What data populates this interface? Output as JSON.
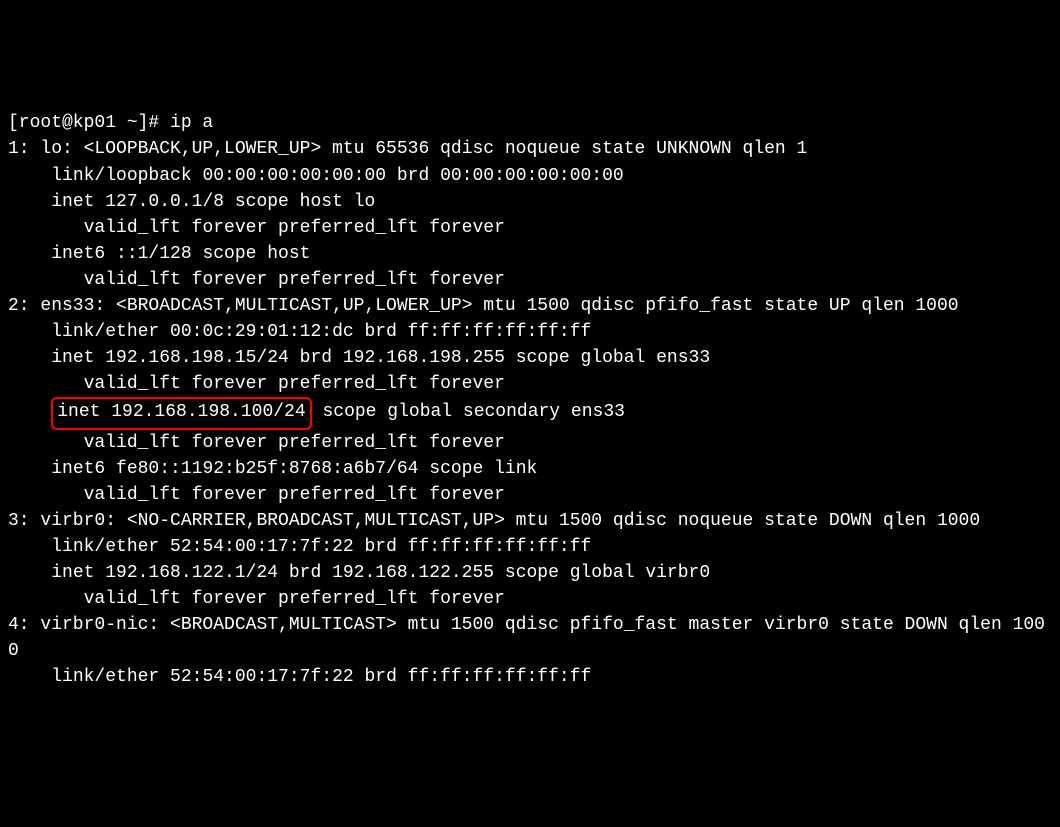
{
  "terminal": {
    "prompt": "[root@kp01 ~]# ",
    "command": "ip a",
    "output": {
      "l00": "1: lo: <LOOPBACK,UP,LOWER_UP> mtu 65536 qdisc noqueue state UNKNOWN qlen 1",
      "l01": "    link/loopback 00:00:00:00:00:00 brd 00:00:00:00:00:00",
      "l02": "    inet 127.0.0.1/8 scope host lo",
      "l03": "       valid_lft forever preferred_lft forever",
      "l04": "    inet6 ::1/128 scope host ",
      "l05": "       valid_lft forever preferred_lft forever",
      "l06": "2: ens33: <BROADCAST,MULTICAST,UP,LOWER_UP> mtu 1500 qdisc pfifo_fast state UP qlen 1000",
      "l07": "    link/ether 00:0c:29:01:12:dc brd ff:ff:ff:ff:ff:ff",
      "l08": "    inet 192.168.198.15/24 brd 192.168.198.255 scope global ens33",
      "l09": "       valid_lft forever preferred_lft forever",
      "l10a": "    ",
      "l10_hl": "inet 192.168.198.100/24",
      "l10b": " scope global secondary ens33",
      "l11": "       valid_lft forever preferred_lft forever",
      "l12": "    inet6 fe80::1192:b25f:8768:a6b7/64 scope link ",
      "l13": "       valid_lft forever preferred_lft forever",
      "l14": "3: virbr0: <NO-CARRIER,BROADCAST,MULTICAST,UP> mtu 1500 qdisc noqueue state DOWN qlen 1000",
      "l15": "    link/ether 52:54:00:17:7f:22 brd ff:ff:ff:ff:ff:ff",
      "l16": "    inet 192.168.122.1/24 brd 192.168.122.255 scope global virbr0",
      "l17": "       valid_lft forever preferred_lft forever",
      "l18": "4: virbr0-nic: <BROADCAST,MULTICAST> mtu 1500 qdisc pfifo_fast master virbr0 state DOWN qlen 1000",
      "l19": "    link/ether 52:54:00:17:7f:22 brd ff:ff:ff:ff:ff:ff"
    }
  }
}
